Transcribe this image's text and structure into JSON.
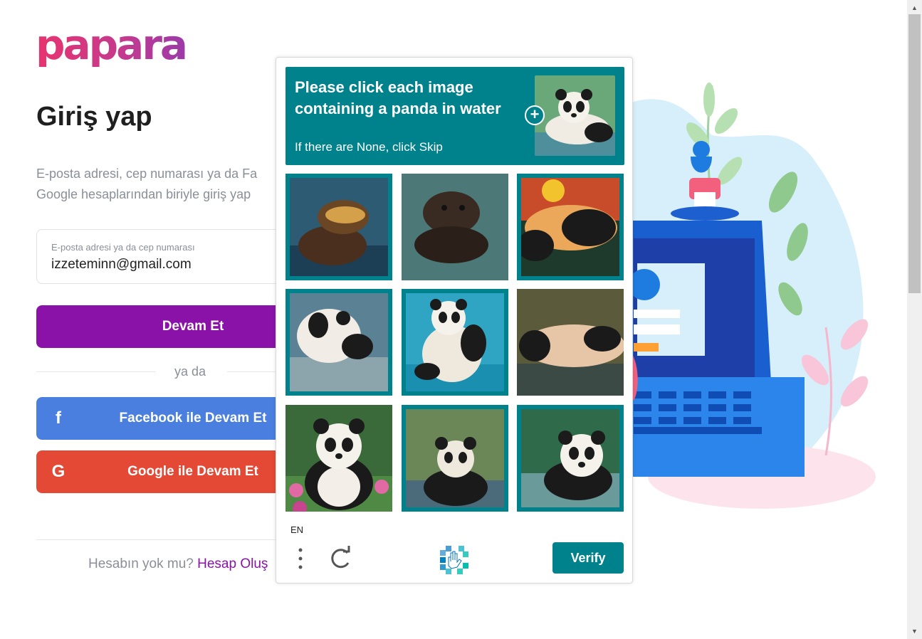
{
  "brand": {
    "logo_text": "papara",
    "accent": "#8b12a8"
  },
  "login": {
    "title": "Giriş yap",
    "description_line1": "E-posta adresi, cep numarası ya da Fa",
    "description_line2": "Google hesaplarından biriyle giriş yap",
    "email_label": "E-posta adresi ya da cep numarası",
    "email_value": "izzeteminn@gmail.com",
    "continue_label": "Devam Et",
    "or_label": "ya da",
    "facebook_label": "Facebook ile Devam Et",
    "facebook_icon": "f",
    "google_label": "Google ile Devam Et",
    "google_icon": "G",
    "no_account": "Hesabın yok mu?",
    "create_account": "Hesap Oluş"
  },
  "captcha": {
    "prompt_line": "Please click each image containing a panda in water",
    "sub_prompt": "If there are None, click Skip",
    "zoom_symbol": "+",
    "language": "EN",
    "verify_label": "Verify",
    "accent": "#00828c",
    "tiles": [
      "otter-in-water",
      "otter-floating",
      "panda-at-sunset",
      "panda-swimming",
      "panda-in-pool",
      "panda-lying",
      "panda-in-flowers",
      "panda-sitting-water",
      "panda-in-stream"
    ]
  }
}
